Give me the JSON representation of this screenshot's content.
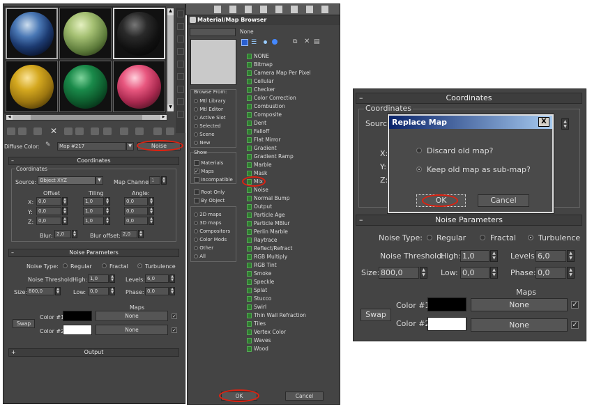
{
  "left_panel": {
    "diffuse_label": "Diffuse Color:",
    "map_name": "Map #217",
    "map_type": "Noise",
    "coordinates": {
      "title": "Coordinates",
      "group_label": "Coordinates",
      "source_label": "Source:",
      "source_value": "Object XYZ",
      "map_channel_label": "Map Channel:",
      "map_channel_value": "1",
      "offset_label": "Offset",
      "tiling_label": "Tiling",
      "angle_label": "Angle:",
      "x_label": "X:",
      "y_label": "Y:",
      "z_label": "Z:",
      "offset": [
        "0,0",
        "0,0",
        "0,0"
      ],
      "tiling": [
        "1,0",
        "1,0",
        "1,0"
      ],
      "angle": [
        "0,0",
        "0,0",
        "0,0"
      ],
      "blur_label": "Blur:",
      "blur_value": "2,0",
      "blur_offset_label": "Blur offset:",
      "blur_offset_value": "2,0"
    },
    "noise": {
      "title": "Noise Parameters",
      "type_label": "Noise Type:",
      "regular": "Regular",
      "fractal": "Fractal",
      "turbulence": "Turbulence",
      "threshold_label": "Noise Threshold:",
      "high_label": "High:",
      "high_value": "1,0",
      "levels_label": "Levels:",
      "levels_value": "6,0",
      "size_label": "Size:",
      "size_value": "800,0",
      "low_label": "Low:",
      "low_value": "0,0",
      "phase_label": "Phase:",
      "phase_value": "0,0",
      "maps_label": "Maps",
      "color1_label": "Color #1",
      "color2_label": "Color #2",
      "swap_label": "Swap",
      "none1": "None",
      "none2": "None"
    },
    "output_title": "Output"
  },
  "browser": {
    "title": "Material/Map Browser",
    "top_field": "None",
    "browse_from_label": "Browse From:",
    "browse_from": [
      "Mtl Library",
      "Mtl Editor",
      "Active Slot",
      "Selected",
      "Scene",
      "New"
    ],
    "show_label": "Show",
    "show": [
      "Materials",
      "Maps",
      "Incompatible"
    ],
    "root_only": "Root Only",
    "by_object": "By Object",
    "categories": [
      "2D maps",
      "3D maps",
      "Compositors",
      "Color Mods",
      "Other",
      "All"
    ],
    "maps": [
      "NONE",
      "Bitmap",
      "Camera Map Per Pixel",
      "Cellular",
      "Checker",
      "Color Correction",
      "Combustion",
      "Composite",
      "Dent",
      "Falloff",
      "Flat Mirror",
      "Gradient",
      "Gradient Ramp",
      "Marble",
      "Mask",
      "Mix",
      "Noise",
      "Normal Bump",
      "Output",
      "Particle Age",
      "Particle MBlur",
      "Perlin Marble",
      "Raytrace",
      "Reflect/Refract",
      "RGB Multiply",
      "RGB Tint",
      "Smoke",
      "Speckle",
      "Splat",
      "Stucco",
      "Swirl",
      "Thin Wall Refraction",
      "Tiles",
      "Vertex Color",
      "Waves",
      "Wood"
    ],
    "ok": "OK",
    "cancel": "Cancel"
  },
  "right_panel": {
    "coordinates_title": "Coordinates",
    "coordinates_group": "Coordinates",
    "source_partial": "Source",
    "x_label": "X:",
    "y_label": "Y:",
    "z_label": "Z:",
    "dialog": {
      "title": "Replace Map",
      "close": "X",
      "discard": "Discard old map?",
      "keep": "Keep old map as sub-map?",
      "ok": "OK",
      "cancel": "Cancel"
    },
    "noise": {
      "title": "Noise Parameters",
      "type_label": "Noise Type:",
      "regular": "Regular",
      "fractal": "Fractal",
      "turbulence": "Turbulence",
      "threshold_label": "Noise Threshold:",
      "high_label": "High:",
      "high_value": "1,0",
      "levels_label": "Levels:",
      "levels_value": "6,0",
      "size_label": "Size:",
      "size_value": "800,0",
      "low_label": "Low:",
      "low_value": "0,0",
      "phase_label": "Phase:",
      "phase_value": "0,0",
      "maps_label": "Maps",
      "color1_label": "Color #1",
      "color2_label": "Color #2",
      "swap_label": "Swap",
      "none1": "None",
      "none2": "None"
    }
  },
  "colors": {
    "panel_bg": "#444444",
    "highlight_red": "#dd2211",
    "dialog_title_blue": "#0a246a",
    "map_icon_green": "#2e7d2e"
  }
}
